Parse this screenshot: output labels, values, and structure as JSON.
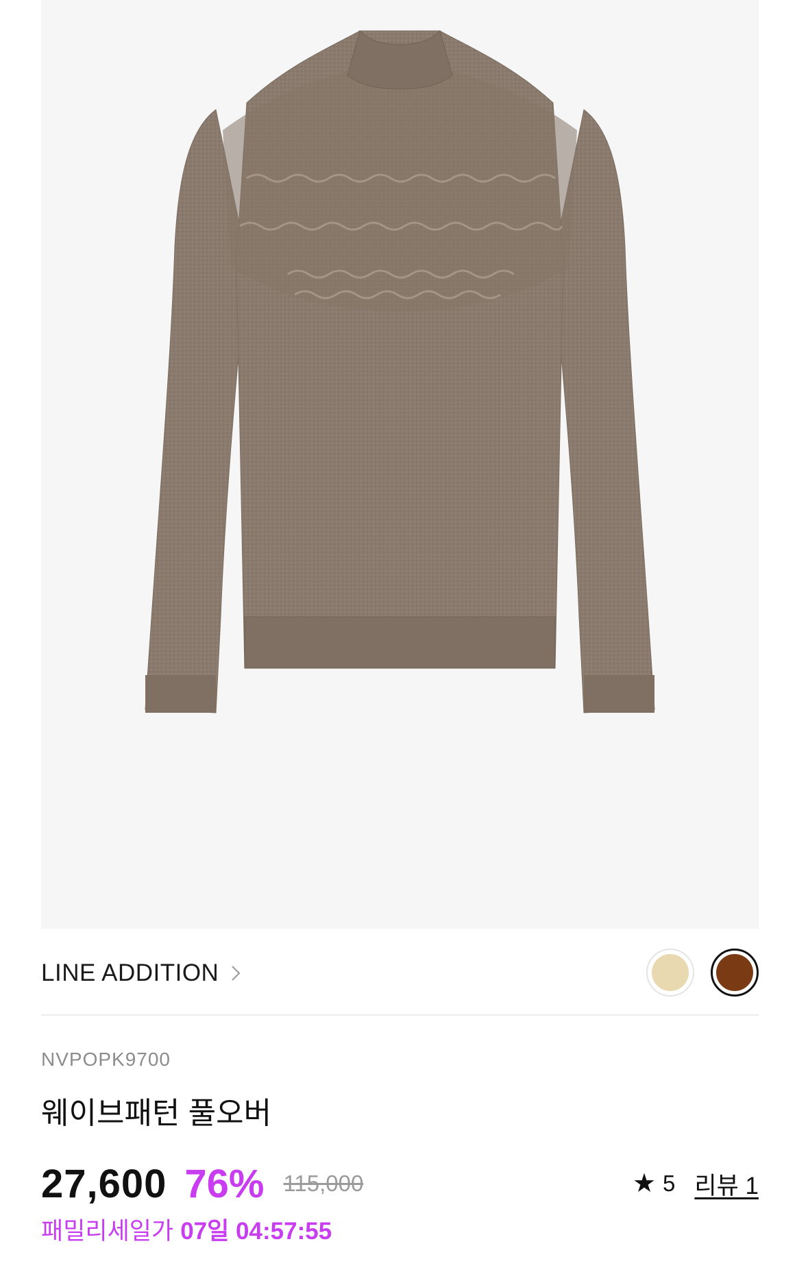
{
  "product": {
    "image_alt": "wave pattern pullover sweater, taupe brown",
    "image_bg_color": "#f6f6f7",
    "sweater_color": "#8a7b6e",
    "brand": "LINE ADDITION",
    "code": "NVPOPK9700",
    "name": "웨이브패턴 풀오버",
    "colors": [
      {
        "name": "beige",
        "hex": "#e8d9b0",
        "selected": false
      },
      {
        "name": "brown",
        "hex": "#7a3a14",
        "selected": true
      }
    ]
  },
  "pricing": {
    "sale_price": "27,600",
    "discount_rate": "76%",
    "original_price": "115,000",
    "family_sale_label": "패밀리세일가",
    "family_sale_timer": "07일 04:57:55",
    "accent_color": "#c93df0"
  },
  "rating": {
    "star_icon": "star-icon",
    "score": "5",
    "review_label": "리뷰 1"
  }
}
